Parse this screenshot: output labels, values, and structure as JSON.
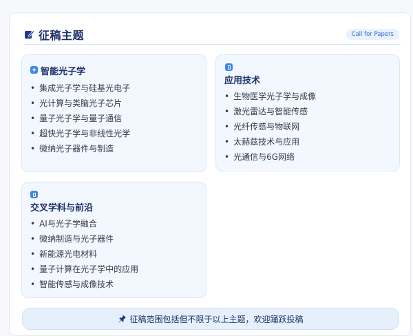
{
  "header": {
    "title": "征稿主题",
    "badge": "Call for Papers"
  },
  "sections": [
    {
      "title": "智能光子学",
      "items": [
        "集成光子学与硅基光电子",
        "光计算与类脑光子芯片",
        "量子光子学与量子通信",
        "超快光子学与非线性光学",
        "微纳光子器件与制造"
      ]
    },
    {
      "title": "应用技术",
      "items": [
        "生物医学光子学与成像",
        "激光雷达与智能传感",
        "光纤传感与物联网",
        "太赫兹技术与应用",
        "光通信与6G网络"
      ]
    },
    {
      "title": "交叉学科与前沿",
      "items": [
        "AI与光子学融合",
        "微纳制造与光子器件",
        "新能源光电材料",
        "量子计算在光子学中的应用",
        "智能传感与成像技术"
      ]
    }
  ],
  "footer": {
    "text": "征稿范围包括但不限于以上主题，欢迎踊跃投稿"
  },
  "colors": {
    "accent": "#3f84f0",
    "title": "#1e2f6b",
    "section_bg": "#f3f8ff"
  },
  "icons": {
    "header": "edit-icon",
    "section_1": "sparkle-icon",
    "section_2": "device-icon",
    "section_3": "device-icon",
    "footer": "pin-icon"
  }
}
